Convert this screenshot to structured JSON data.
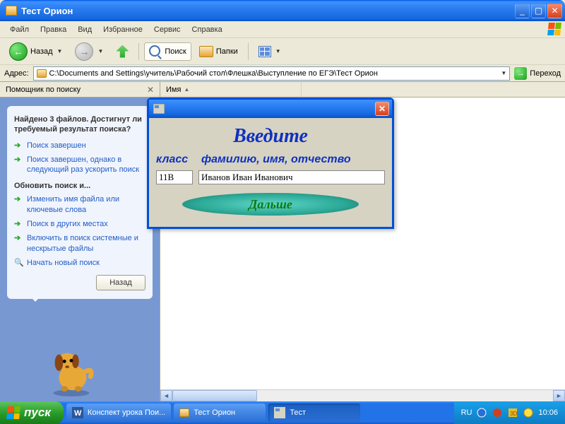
{
  "window": {
    "title": "Тест Орион"
  },
  "menu": [
    "Файл",
    "Правка",
    "Вид",
    "Избранное",
    "Сервис",
    "Справка"
  ],
  "toolbar": {
    "back": "Назад",
    "search": "Поиск",
    "folders": "Папки"
  },
  "address": {
    "label": "Адрес:",
    "path": "C:\\Documents and Settings\\учитель\\Рабочий стол\\Флешка\\Выступление по ЕГЭ\\Тест Орион",
    "go": "Переход"
  },
  "sidebar": {
    "header": "Помощник по поиску",
    "heading": "Найдено 3 файлов. Достигнут ли требуемый результат поиска?",
    "items1": [
      "Поиск завершен",
      "Поиск завершен, однако в следующий раз ускорить поиск"
    ],
    "sub": "Обновить поиск и...",
    "items2": [
      "Изменить имя файла или ключевые слова",
      "Поиск в других местах",
      "Включить в поиск системные и нескрытые файлы"
    ],
    "newsearch": "Начать новый поиск",
    "back": "Назад"
  },
  "columns": {
    "name": "Имя"
  },
  "dialog": {
    "title": "Введите",
    "label_class": "класс",
    "label_fio": "фамилию, имя, отчество",
    "value_class": "11В",
    "value_fio": "Иванов Иван Иванович",
    "next": "Дальше"
  },
  "taskbar": {
    "start": "пуск",
    "items": [
      {
        "label": "Конспект урока Пои...",
        "active": false
      },
      {
        "label": "Тест Орион",
        "active": false
      },
      {
        "label": "Тест",
        "active": true
      }
    ],
    "lang": "RU",
    "clock": "10:06"
  }
}
